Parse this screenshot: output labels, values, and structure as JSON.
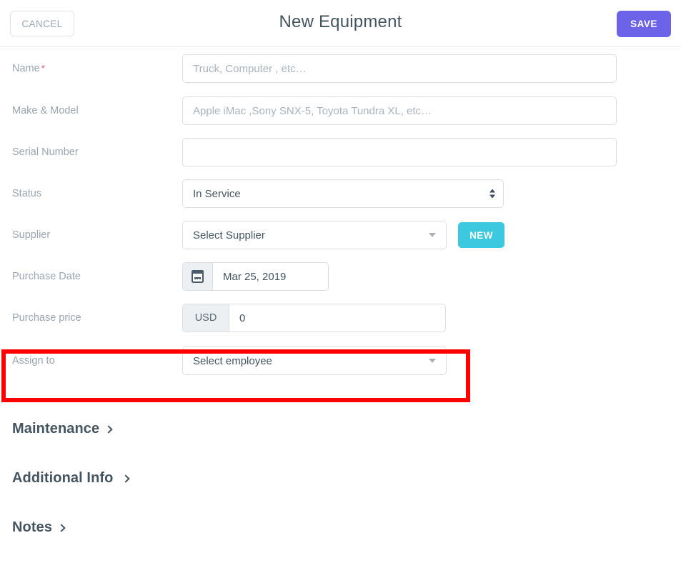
{
  "header": {
    "cancel_label": "CANCEL",
    "title": "New Equipment",
    "save_label": "SAVE",
    "save_color": "#6C63E8"
  },
  "form": {
    "name": {
      "label": "Name",
      "required_marker": "*",
      "placeholder": "Truck, Computer , etc…",
      "value": ""
    },
    "make_model": {
      "label": "Make & Model",
      "placeholder": "Apple iMac ,Sony SNX-5, Toyota Tundra XL, etc…",
      "value": ""
    },
    "serial_number": {
      "label": "Serial Number",
      "placeholder": "",
      "value": ""
    },
    "status": {
      "label": "Status",
      "selected": "In Service",
      "options": [
        "In Service"
      ]
    },
    "supplier": {
      "label": "Supplier",
      "selected": "Select Supplier",
      "new_button": "NEW",
      "new_button_color": "#3CC8DE"
    },
    "purchase_date": {
      "label": "Purchase Date",
      "value": "Mar 25, 2019",
      "icon": "calendar-icon"
    },
    "purchase_price": {
      "label": "Purchase price",
      "currency": "USD",
      "value": "0"
    },
    "assign_to": {
      "label": "Assign to",
      "selected": "Select employee",
      "highlight_color": "#FF0000"
    }
  },
  "sections": [
    {
      "label": "Maintenance"
    },
    {
      "label": "Additional Info"
    },
    {
      "label": "Notes"
    }
  ]
}
